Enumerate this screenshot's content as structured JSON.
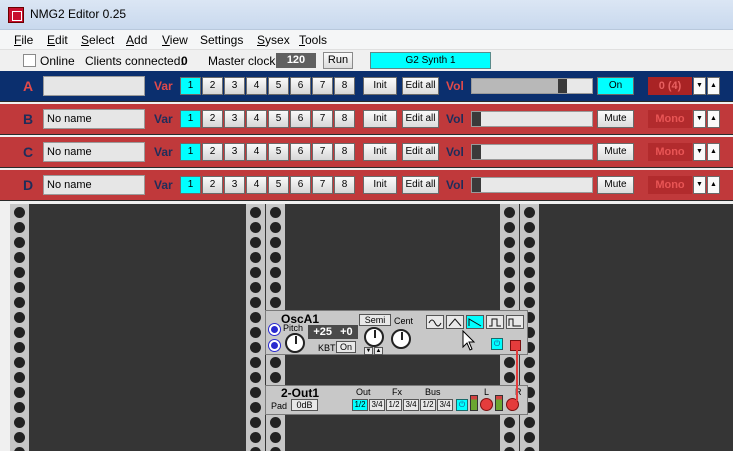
{
  "window": {
    "title": "NMG2 Editor 0.25"
  },
  "menu": [
    {
      "u": "F",
      "rest": "ile"
    },
    {
      "u": "E",
      "rest": "dit"
    },
    {
      "u": "S",
      "rest": "elect"
    },
    {
      "u": "A",
      "rest": "dd"
    },
    {
      "u": "V",
      "rest": "iew"
    },
    {
      "u": "",
      "rest": "Settings"
    },
    {
      "u": "S",
      "rest": "ysex"
    },
    {
      "u": "T",
      "rest": "ools"
    }
  ],
  "toolbar": {
    "online_label": "Online",
    "online_checked": false,
    "clients_label": "Clients connected:",
    "clients_value": "0",
    "master_clock_label": "Master clock",
    "master_clock_value": "120",
    "run_label": "Run",
    "synth_name": "G2 Synth 1"
  },
  "slots": [
    {
      "letter": "A",
      "name": "",
      "var_label": "Var",
      "vars": [
        "1",
        "2",
        "3",
        "4",
        "5",
        "6",
        "7",
        "8"
      ],
      "selected_var": 0,
      "init_label": "Init",
      "edit_all_label": "Edit all",
      "vol_label": "Vol",
      "vol_level": 0.75,
      "mute_label": "On",
      "mode": "0 (4)",
      "active": true
    },
    {
      "letter": "B",
      "name": "No name",
      "var_label": "Var",
      "vars": [
        "1",
        "2",
        "3",
        "4",
        "5",
        "6",
        "7",
        "8"
      ],
      "selected_var": 0,
      "init_label": "Init",
      "edit_all_label": "Edit all",
      "vol_label": "Vol",
      "vol_level": 0.0,
      "mute_label": "Mute",
      "mode": "Mono",
      "active": false
    },
    {
      "letter": "C",
      "name": "No name",
      "var_label": "Var",
      "vars": [
        "1",
        "2",
        "3",
        "4",
        "5",
        "6",
        "7",
        "8"
      ],
      "selected_var": 0,
      "init_label": "Init",
      "edit_all_label": "Edit all",
      "vol_label": "Vol",
      "vol_level": 0.0,
      "mute_label": "Mute",
      "mode": "Mono",
      "active": false
    },
    {
      "letter": "D",
      "name": "No name",
      "var_label": "Var",
      "vars": [
        "1",
        "2",
        "3",
        "4",
        "5",
        "6",
        "7",
        "8"
      ],
      "selected_var": 0,
      "init_label": "Init",
      "edit_all_label": "Edit all",
      "vol_label": "Vol",
      "vol_level": 0.0,
      "mute_label": "Mute",
      "mode": "Mono",
      "active": false
    }
  ],
  "osc_module": {
    "title": "OscA1",
    "pitch_label": "Pitch",
    "semi_label": "Semi",
    "cent_label": "Cent",
    "semi_value": "+25",
    "cent_value": "+0",
    "kbt_label": "KBT",
    "kbt_value": "On",
    "waveforms": [
      "sine-wave-icon",
      "triangle-wave-icon",
      "saw-wave-icon",
      "pulse-wave-icon",
      "square-wave-icon"
    ],
    "selected_waveform": 2
  },
  "out_module": {
    "title": "2-Out1",
    "pad_label": "Pad",
    "pad_value": "0dB",
    "out_label": "Out",
    "fx_label": "Fx",
    "bus_label": "Bus",
    "l_label": "L",
    "r_label": "R",
    "out_opts": [
      "1/2",
      "3/4"
    ],
    "fx_opts": [
      "1/2",
      "3/4"
    ],
    "bus_opts": [
      "1/2",
      "3/4"
    ],
    "out_selected": 0
  },
  "colors": {
    "active_slot": "#0b2f6e",
    "inactive_slot": "#c0393b",
    "accent_cyan": "#00ffff",
    "canvas": "#353535",
    "cable": "#e43c3c"
  }
}
